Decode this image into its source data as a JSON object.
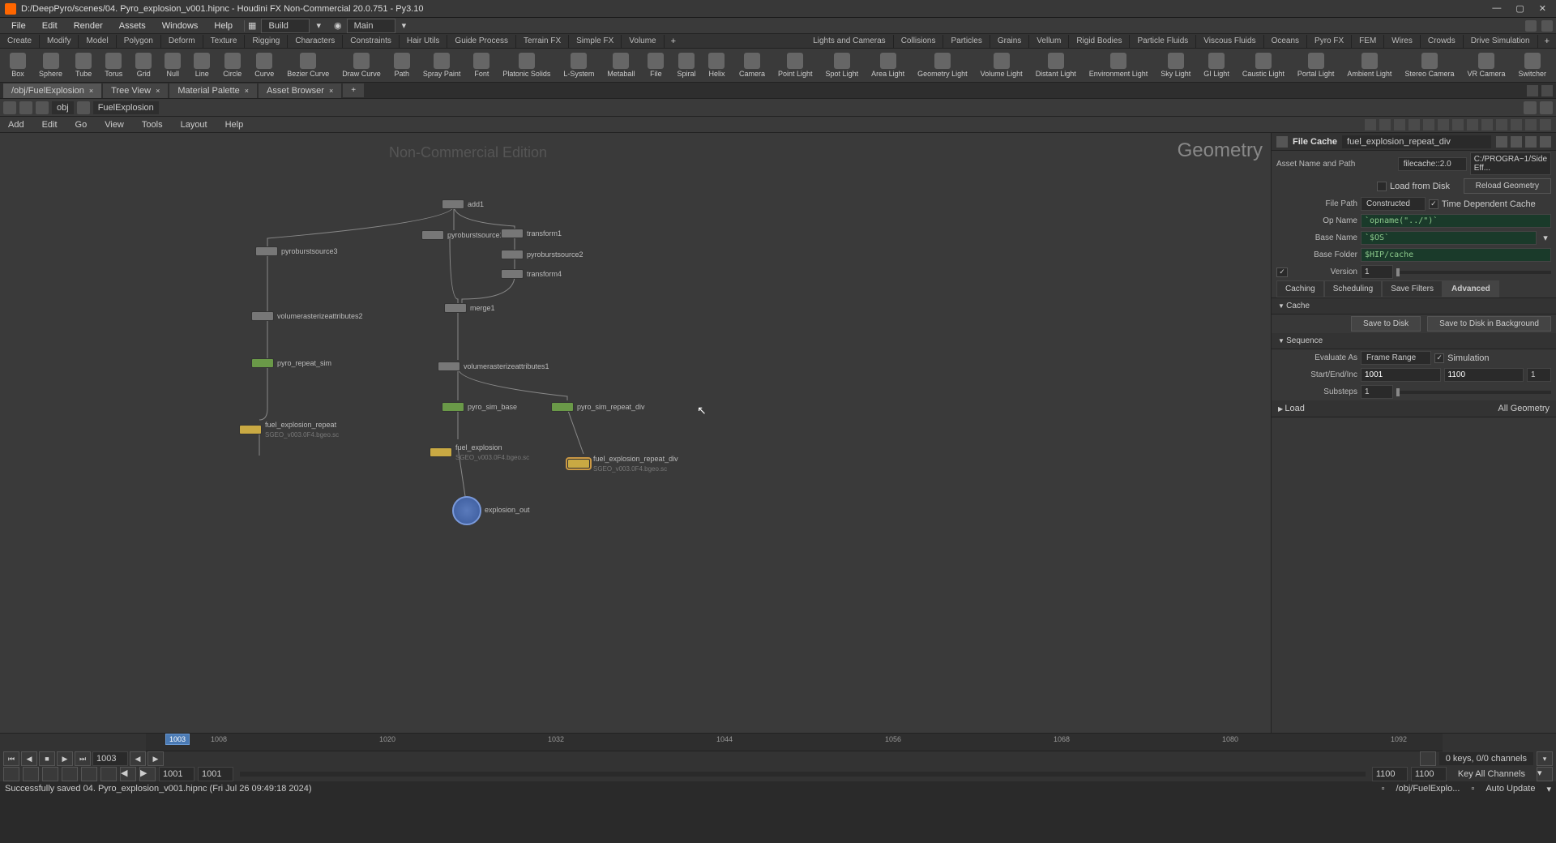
{
  "title": "D:/DeepPyro/scenes/04. Pyro_explosion_v001.hipnc - Houdini FX Non-Commercial 20.0.751 - Py3.10",
  "menu": [
    "File",
    "Edit",
    "Render",
    "Assets",
    "Windows",
    "Help"
  ],
  "desk1": "Build",
  "desk2": "Main",
  "shelfLeftTabs": [
    "Create",
    "Modify",
    "Model",
    "Polygon",
    "Deform",
    "Texture",
    "Rigging",
    "Characters",
    "Constraints",
    "Hair Utils",
    "Guide Process",
    "Terrain FX",
    "Simple FX",
    "Volume"
  ],
  "shelfRightTabs": [
    "Lights and Cameras",
    "Collisions",
    "Particles",
    "Grains",
    "Vellum",
    "Rigid Bodies",
    "Particle Fluids",
    "Viscous Fluids",
    "Oceans",
    "Pyro FX",
    "FEM",
    "Wires",
    "Crowds",
    "Drive Simulation"
  ],
  "toolsLeft": [
    "Box",
    "Sphere",
    "Tube",
    "Torus",
    "Grid",
    "Null",
    "Line",
    "Circle",
    "Curve",
    "Bezier Curve",
    "Draw Curve",
    "Path",
    "Spray Paint",
    "Font",
    "Platonic Solids",
    "L-System",
    "Metaball",
    "File",
    "Spiral",
    "Helix"
  ],
  "toolsRight": [
    "Camera",
    "Point Light",
    "Spot Light",
    "Area Light",
    "Geometry Light",
    "Volume Light",
    "Distant Light",
    "Environment Light",
    "Sky Light",
    "GI Light",
    "Caustic Light",
    "Portal Light",
    "Ambient Light",
    "Stereo Camera",
    "VR Camera",
    "Switcher"
  ],
  "panelTabs": [
    "/obj/FuelExplosion",
    "Tree View",
    "Material Palette",
    "Asset Browser"
  ],
  "pathSegs": [
    "obj",
    "FuelExplosion"
  ],
  "netMenu": [
    "Add",
    "Edit",
    "Go",
    "View",
    "Tools",
    "Layout",
    "Help"
  ],
  "watermark": "Non-Commercial Edition",
  "contextLabel": "Geometry",
  "nodes": {
    "add1": "add1",
    "pyroburstsource1": "pyroburstsource1",
    "pyroburstsource3": "pyroburstsource3",
    "transform1": "transform1",
    "pyroburstsource2": "pyroburstsource2",
    "transform4": "transform4",
    "merge1": "merge1",
    "volumerasterizeattributes2": "volumerasterizeattributes2",
    "pyro_repeat_sim": "pyro_repeat_sim",
    "volumerasterizeattributes1": "volumerasterizeattributes1",
    "pyro_sim_base": "pyro_sim_base",
    "pyro_sim_repeat_div": "pyro_sim_repeat_div",
    "fuel_explosion_repeat": "fuel_explosion_repeat",
    "fuel_explosion": "fuel_explosion",
    "fuel_explosion_repeat_div": "fuel_explosion_repeat_div",
    "explosion_out": "explosion_out",
    "subRepeat": "SGEO_v003.0F4.bgeo.sc",
    "subExplosion": "SGEO_v003.0F4.bgeo.sc",
    "subRepeatDiv": "SGEO_v003.0F4.bgeo.sc"
  },
  "parm": {
    "type": "File Cache",
    "name": "fuel_explosion_repeat_div",
    "assetLbl": "Asset Name and Path",
    "assetType": "filecache::2.0",
    "assetPath": "C:/PROGRA~1/Side Eff...",
    "loadFromDisk": "Load from Disk",
    "reloadGeo": "Reload Geometry",
    "filePathLbl": "File Path",
    "filePathMode": "Constructed",
    "timeDep": "Time Dependent Cache",
    "opNameLbl": "Op Name",
    "opName": "`opname(\"../\")`",
    "baseNameLbl": "Base Name",
    "baseName": "`$OS`",
    "baseFolderLbl": "Base Folder",
    "baseFolder": "$HIP/cache",
    "versionLbl": "Version",
    "version": "1",
    "tabs": [
      "Caching",
      "Scheduling",
      "Save Filters",
      "Advanced"
    ],
    "cacheHdr": "Cache",
    "saveDisk": "Save to Disk",
    "saveDiskBg": "Save to Disk in Background",
    "seqHdr": "Sequence",
    "evalAsLbl": "Evaluate As",
    "evalAs": "Frame Range",
    "simulation": "Simulation",
    "startEndLbl": "Start/End/Inc",
    "start": "1001",
    "end": "1100",
    "inc": "1",
    "substepsLbl": "Substeps",
    "substeps": "1",
    "loadHdr": "Load",
    "loadMode": "All Geometry"
  },
  "timeline": {
    "ticks": [
      "1008",
      "1020",
      "1032",
      "1044",
      "1056",
      "1068",
      "1080",
      "1092"
    ],
    "cur": "1003",
    "curFrame": "1003",
    "start": "1001",
    "start2": "1001",
    "end": "1100",
    "end2": "1100",
    "keys": "0 keys, 0/0 channels",
    "keyAll": "Key All Channels"
  },
  "status": {
    "msg": "Successfully saved 04. Pyro_explosion_v001.hipnc (Fri Jul 26 09:49:18 2024)",
    "path": "/obj/FuelExplo...",
    "update": "Auto Update"
  }
}
